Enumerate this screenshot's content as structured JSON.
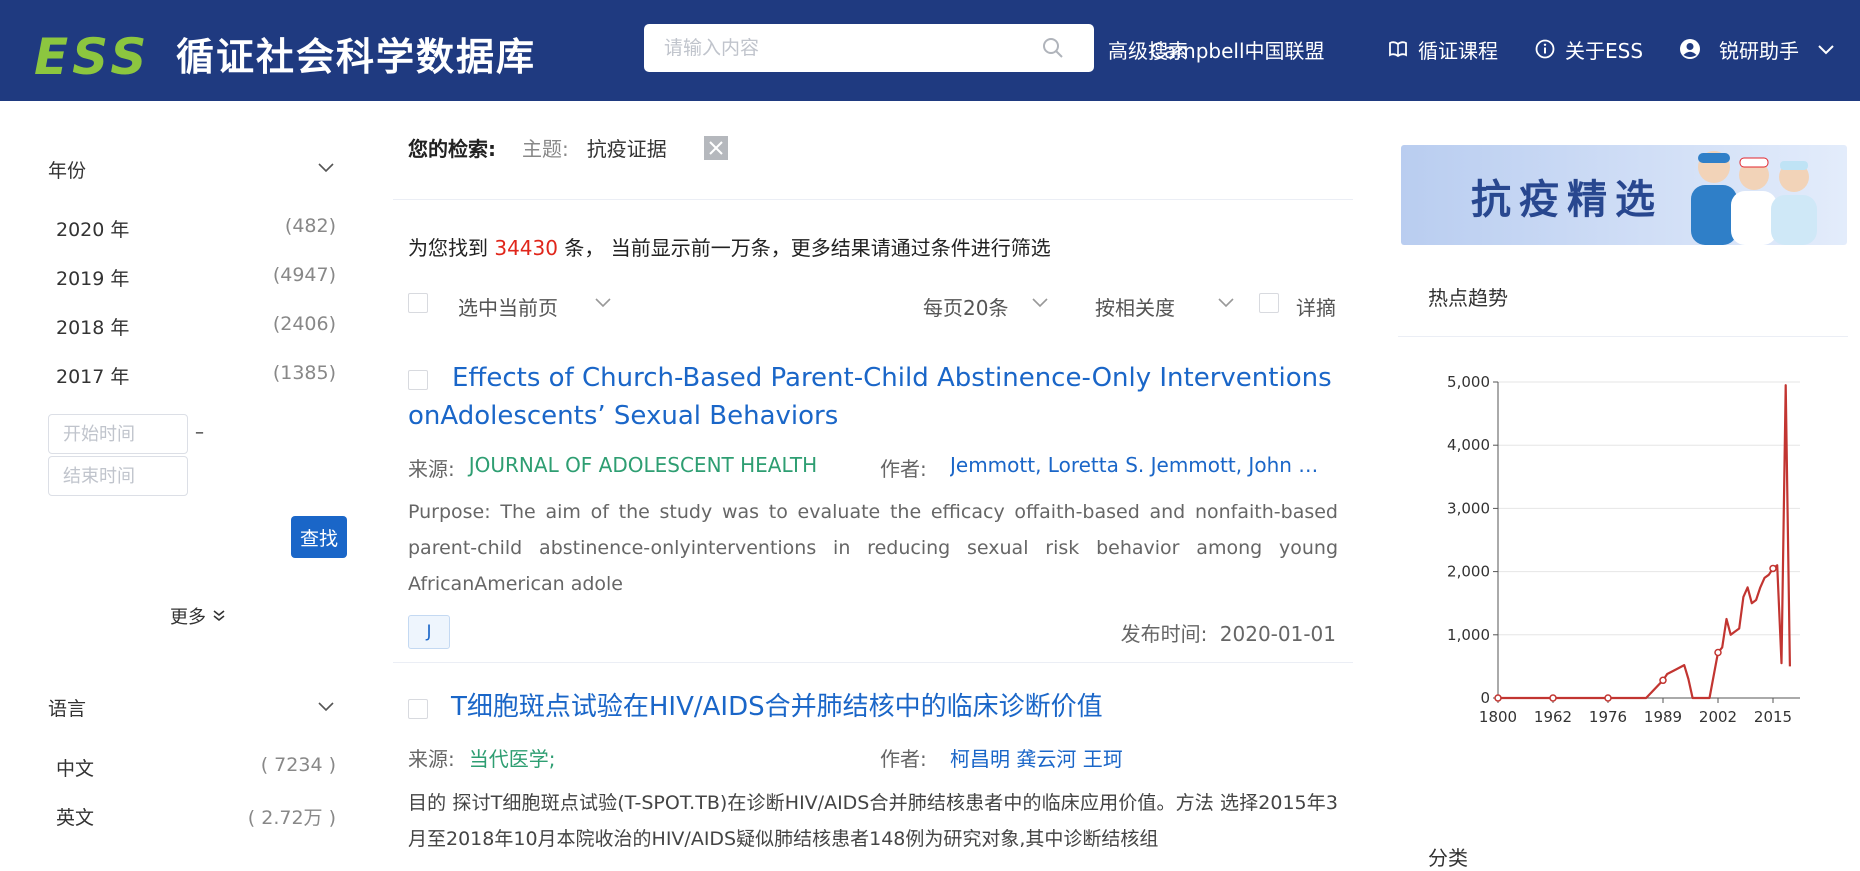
{
  "header": {
    "logo": "ESS",
    "title": "循证社会科学数据库",
    "search_placeholder": "请输入内容",
    "nav": {
      "advanced_search": "高级搜索",
      "campbell": "Campbell中国联盟",
      "course": "循证课程",
      "about": "关于ESS",
      "user": "锐研助手"
    }
  },
  "sidebar": {
    "year_title": "年份",
    "years": [
      {
        "label": "2020 年",
        "count": "(482)"
      },
      {
        "label": "2019 年",
        "count": "(4947)"
      },
      {
        "label": "2018 年",
        "count": "(2406)"
      },
      {
        "label": "2017 年",
        "count": "(1385)"
      }
    ],
    "start_placeholder": "开始时间",
    "end_placeholder": "结束时间",
    "dash": "–",
    "find_label": "查找",
    "more_label": "更多",
    "language_title": "语言",
    "languages": [
      {
        "label": "中文",
        "count": "( 7234 )"
      },
      {
        "label": "英文",
        "count": "( 2.72万 )"
      }
    ]
  },
  "main": {
    "query_label": "您的检索:",
    "query_topic_label": "主题:",
    "query_topic_value": "抗疫证据",
    "found_prefix": "为您找到",
    "found_count": "34430",
    "found_suffix": "条， 当前显示前一万条，更多结果请通过条件进行筛选",
    "select_page_label": "选中当前页",
    "per_page_label": "每页20条",
    "sort_label": "按相关度",
    "detail_label": "详摘",
    "results": [
      {
        "title": "Effects of Church-Based Parent-Child Abstinence-Only Interventions onAdolescents’ Sexual Behaviors",
        "source_label": "来源:",
        "source": "JOURNAL OF ADOLESCENT HEALTH",
        "author_label": "作者:",
        "authors": "Jemmott, Loretta S. Jemmott, John B. O'Leary, Ann",
        "abstract": "Purpose: The aim of the study was to evaluate the efficacy offaith-based and nonfaith-based parent-child abstinence-onlyinterventions in reducing sexual risk behavior among young AfricanAmerican adole",
        "tag": "J",
        "date_label": "发布时间:",
        "date": "2020-01-01"
      },
      {
        "title": "T细胞斑点试验在HIV/AIDS合并肺结核中的临床诊断价值",
        "source_label": "来源:",
        "source": "当代医学;",
        "author_label": "作者:",
        "authors": "柯昌明 龚云河 王珂",
        "abstract": "目的 探讨T细胞斑点试验(T-SPOT.TB)在诊断HIV/AIDS合并肺结核患者中的临床应用价值。方法 选择2015年3月至2018年10月本院收治的HIV/AIDS疑似肺结核患者148例为研究对象,其中诊断结核组"
      }
    ]
  },
  "right": {
    "banner_text": "抗疫精选",
    "hot_title": "热点趋势",
    "category_title": "分类"
  },
  "chart_data": {
    "type": "line",
    "x_tick_labels": [
      "1800",
      "1962",
      "1976",
      "1989",
      "2002",
      "2015"
    ],
    "y_tick_labels": [
      "0",
      "1,000",
      "2,000",
      "3,000",
      "4,000",
      "5,000"
    ],
    "ylim": [
      0,
      5000
    ],
    "grid": true,
    "series": [
      {
        "color": "#c23531",
        "x": [
          1800,
          1962,
          1976,
          1985,
          1989,
          1990,
          1992,
          1994,
          1995,
          1996,
          1998,
          2000,
          2002,
          2003,
          2004,
          2005,
          2006,
          2007,
          2008,
          2009,
          2010,
          2011,
          2012,
          2013,
          2014,
          2015,
          2016,
          2017,
          2018,
          2019
        ],
        "y": [
          0,
          0,
          0,
          0,
          280,
          380,
          450,
          520,
          300,
          0,
          0,
          0,
          720,
          800,
          1250,
          1000,
          1050,
          1100,
          1600,
          1750,
          1500,
          1550,
          1750,
          1900,
          1950,
          2050,
          2100,
          550,
          4950,
          500
        ]
      }
    ]
  }
}
